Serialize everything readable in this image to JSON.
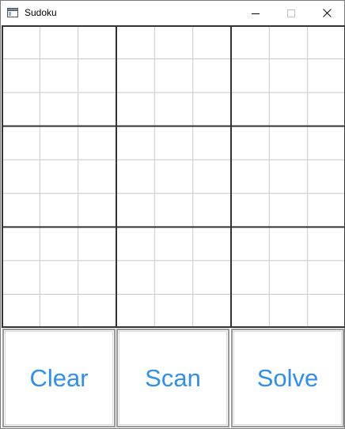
{
  "window": {
    "title": "Sudoku",
    "controls": {
      "minimize_icon": "minimize-icon",
      "maximize_icon": "maximize-icon",
      "close_icon": "close-icon"
    }
  },
  "board": {
    "rows": 9,
    "cols": 9,
    "cells": [
      [
        "",
        "",
        "",
        "",
        "",
        "",
        "",
        "",
        ""
      ],
      [
        "",
        "",
        "",
        "",
        "",
        "",
        "",
        "",
        ""
      ],
      [
        "",
        "",
        "",
        "",
        "",
        "",
        "",
        "",
        ""
      ],
      [
        "",
        "",
        "",
        "",
        "",
        "",
        "",
        "",
        ""
      ],
      [
        "",
        "",
        "",
        "",
        "",
        "",
        "",
        "",
        ""
      ],
      [
        "",
        "",
        "",
        "",
        "",
        "",
        "",
        "",
        ""
      ],
      [
        "",
        "",
        "",
        "",
        "",
        "",
        "",
        "",
        ""
      ],
      [
        "",
        "",
        "",
        "",
        "",
        "",
        "",
        "",
        ""
      ],
      [
        "",
        "",
        "",
        "",
        "",
        "",
        "",
        "",
        ""
      ]
    ]
  },
  "actions": {
    "clear_label": "Clear",
    "scan_label": "Scan",
    "solve_label": "Solve"
  },
  "colors": {
    "button_text": "#2f8ff0",
    "box_border": "#333333",
    "cell_border": "#c8c8c8"
  }
}
